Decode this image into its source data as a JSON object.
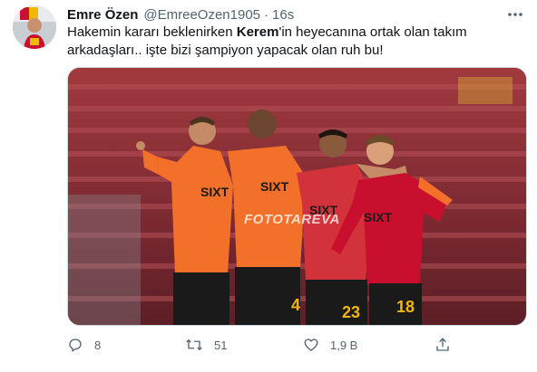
{
  "tweet": {
    "display_name": "Emre Özen",
    "handle": "@EmreeOzen1905",
    "separator": "·",
    "time": "16s",
    "text_part1": "Hakemin kararı beklenirken ",
    "text_bold": "Kerem",
    "text_part2": "'in heyecanına ortak olan takım arkadaşları.. işte bizi şampiyon yapacak olan ruh bu!"
  },
  "media": {
    "watermark": "FOTOTAREVA",
    "jersey_numbers": [
      "4",
      "23",
      "18"
    ],
    "sponsor": "SIXT",
    "colors": {
      "stands": "#8b2c34",
      "kit_orange": "#f2702a",
      "kit_red": "#c8102e",
      "shorts": "#1a1a1a"
    }
  },
  "actions": {
    "reply": {
      "icon": "reply-icon",
      "count": "8"
    },
    "retweet": {
      "icon": "retweet-icon",
      "count": "51"
    },
    "like": {
      "icon": "like-icon",
      "count": "1,9 B"
    },
    "share": {
      "icon": "share-icon"
    }
  },
  "colors": {
    "secondary_text": "#536471",
    "border": "#cfd9de"
  }
}
